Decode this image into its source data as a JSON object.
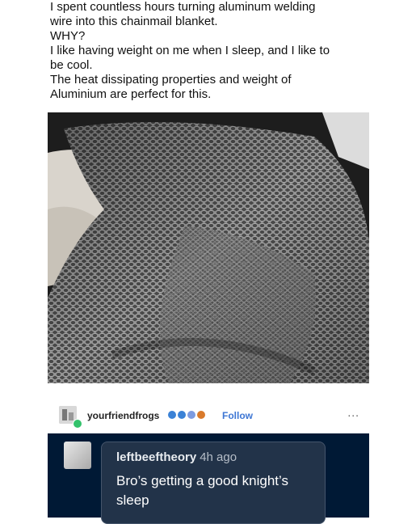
{
  "caption": {
    "lines": [
      "I spent countless hours turning aluminum welding",
      "wire into this chainmail blanket.",
      "WHY?",
      "I like having weight on me when I sleep, and I like to",
      "be cool.",
      "The heat dissipating properties and weight of",
      "Aluminium are perfect for this."
    ]
  },
  "post": {
    "username": "yourfriendfrogs",
    "follow_label": "Follow",
    "more_label": "...",
    "badge_colors": [
      "#3b82d6",
      "#3b82d6",
      "#7d9be0",
      "#d97a2b"
    ]
  },
  "reply": {
    "username": "leftbeeftheory",
    "time": "4h ago",
    "text": "Bro’s getting a good knight’s sleep"
  },
  "colors": {
    "reply_background": "#001935",
    "bubble_background": "#223349",
    "follow_blue": "#3d76d4"
  }
}
